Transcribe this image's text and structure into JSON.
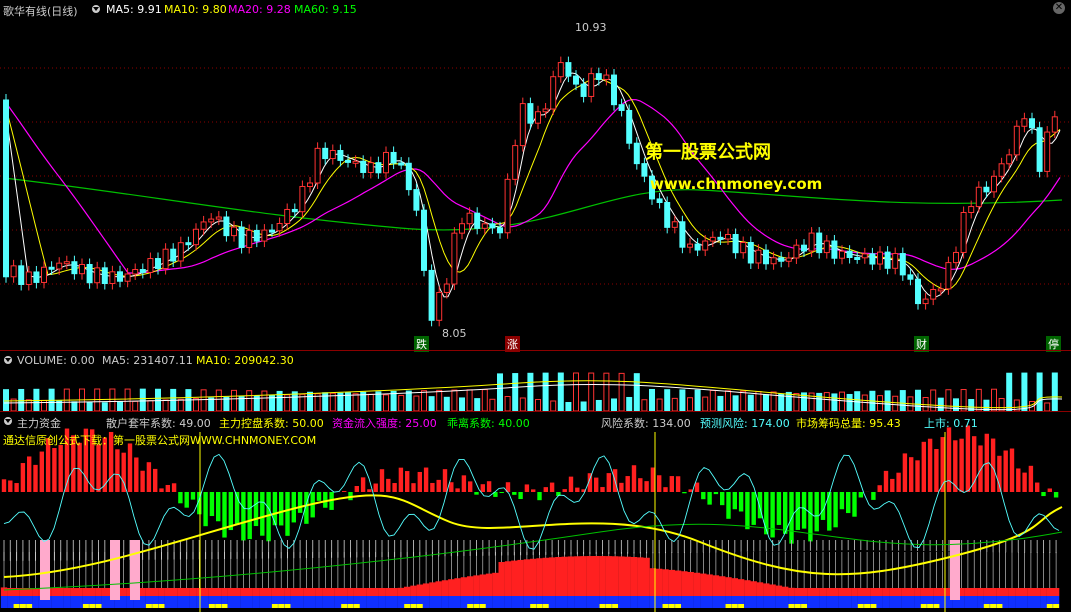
{
  "main_panel": {
    "title": "歌华有线(日线)",
    "ma5": "MA5: 9.91",
    "ma10": "MA10: 9.80",
    "ma20": "MA20: 9.28",
    "ma60": "MA60: 9.15",
    "high_label": "10.93",
    "low_label": "8.05",
    "watermark_cn": "第一股票公式网",
    "watermark_url": "www.chnmoney.com",
    "markers": [
      "跌",
      "涨",
      "财",
      "停"
    ],
    "colors": {
      "ma5": "#ffffff",
      "ma10": "#ffff00",
      "ma20": "#ff00ff",
      "ma60": "#00ff00",
      "up": "#ff3333",
      "down": "#54ffff"
    }
  },
  "volume_panel": {
    "label": "VOLUME: 0.00",
    "ma5": "MA5: 231407.11",
    "ma10": "MA10: 209042.30"
  },
  "indicator_panel": {
    "name": "主力资金",
    "params": [
      {
        "text": "散户套牢系数: 49.00",
        "color": "#cccccc"
      },
      {
        "text": "主力控盘系数: 50.00",
        "color": "#ffff00"
      },
      {
        "text": "资金流入强度: 25.00",
        "color": "#ff00ff"
      },
      {
        "text": "乖离系数: 40.00",
        "color": "#00ff00"
      },
      {
        "text": "风险系数: 134.00",
        "color": "#cccccc"
      },
      {
        "text": "预测风险: 174.00",
        "color": "#54ffff"
      },
      {
        "text": "市场筹码总量: 95.43",
        "color": "#ffff00"
      },
      {
        "text": "上市: 0.71",
        "color": "#54ffff"
      }
    ],
    "promo": "通达信原创公式下载：第一股票公式网WWW.CHNMONEY.COM"
  }
}
